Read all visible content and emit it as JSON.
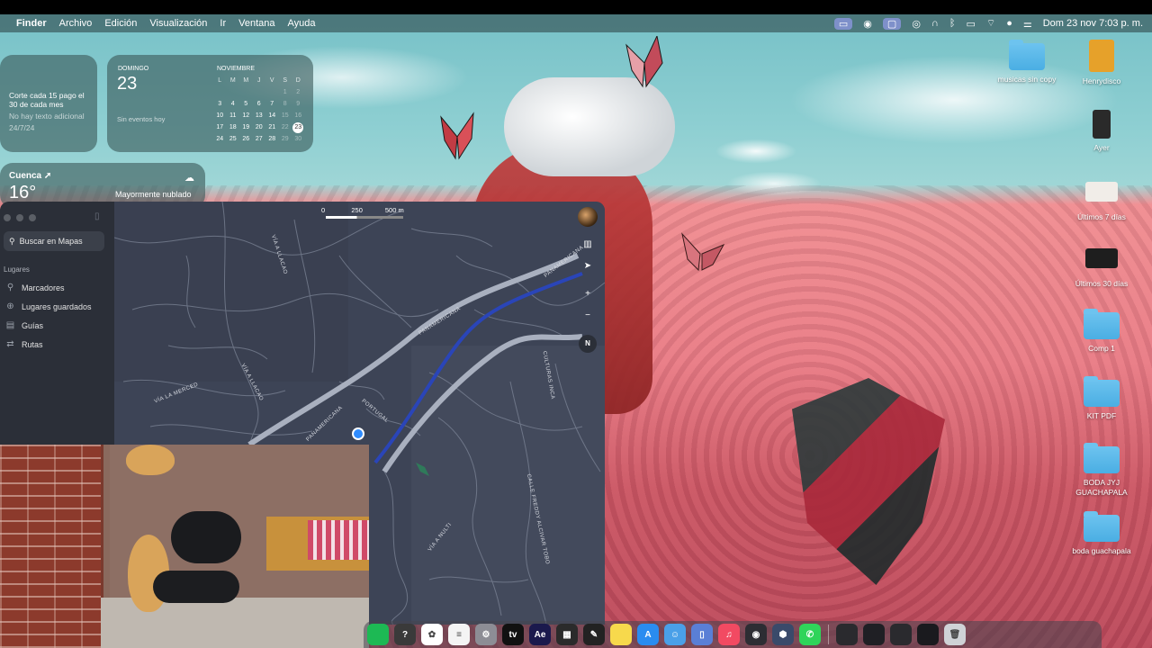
{
  "menubar": {
    "app": "Finder",
    "menus": [
      "Archivo",
      "Edición",
      "Visualización",
      "Ir",
      "Ventana",
      "Ayuda"
    ],
    "clock": "Dom 23 nov  7:03 p. m."
  },
  "widgets": {
    "reminder": {
      "text": "Corte cada 15 pago el 30 de cada mes",
      "note": "No hay texto adicional",
      "date": "24/7/24"
    },
    "calendar": {
      "day_name": "DOMINGO",
      "day_number": "23",
      "no_events": "Sin eventos hoy",
      "month": "NOVIEMBRE",
      "weekdays": [
        "L",
        "M",
        "M",
        "J",
        "V",
        "S",
        "D"
      ],
      "weeks": [
        [
          "",
          "",
          "",
          "",
          "",
          "1",
          "2"
        ],
        [
          "3",
          "4",
          "5",
          "6",
          "7",
          "8",
          "9"
        ],
        [
          "10",
          "11",
          "12",
          "13",
          "14",
          "15",
          "16"
        ],
        [
          "17",
          "18",
          "19",
          "20",
          "21",
          "22",
          "23"
        ],
        [
          "24",
          "25",
          "26",
          "27",
          "28",
          "29",
          "30"
        ]
      ]
    },
    "weather": {
      "city": "Cuenca",
      "temp": "16°",
      "condition": "Mayormente nublado"
    }
  },
  "maps": {
    "search_placeholder": "Buscar en Mapas",
    "places_heading": "Lugares",
    "sidebar_items": [
      {
        "label": "Marcadores",
        "icon": "pin-icon"
      },
      {
        "label": "Lugares guardados",
        "icon": "plus-circle-icon"
      },
      {
        "label": "Guías",
        "icon": "book-icon"
      },
      {
        "label": "Rutas",
        "icon": "route-icon"
      }
    ],
    "scale_labels": [
      "0",
      "250",
      "500 m"
    ],
    "compass": "N",
    "road_labels": [
      "PANAMERICANA",
      "PANAMERICANA",
      "PANAMERICANA",
      "VÍA A LLACAO",
      "VÍA A LLACAO",
      "VÍA LA MERCED",
      "PORTUGAL",
      "VÍA A NULTI",
      "CALLE FREDDY ALCIVAR TOBO",
      "CULTURAS INCA"
    ]
  },
  "desktop_icons": [
    {
      "label": "musicas sin copy",
      "kind": "folder"
    },
    {
      "label": "Henrydisco",
      "kind": "file"
    },
    {
      "label": "Ayer",
      "kind": "image"
    },
    {
      "label": "Últimos 7 días",
      "kind": "image"
    },
    {
      "label": "Últimos 30 días",
      "kind": "image"
    },
    {
      "label": "Comp 1",
      "kind": "folder"
    },
    {
      "label": "KIT PDF",
      "kind": "folder"
    },
    {
      "label": "BODA JYJ GUACHAPALA",
      "kind": "folder"
    },
    {
      "label": "boda guachapala",
      "kind": "folder"
    }
  ],
  "dock": [
    {
      "name": "spotify-icon",
      "glyph": "",
      "color": "#1db954"
    },
    {
      "name": "help-icon",
      "glyph": "?",
      "color": "#3a3a3a"
    },
    {
      "name": "photos-icon",
      "glyph": "✿",
      "color": "#ffffff"
    },
    {
      "name": "reminders-icon",
      "glyph": "≡",
      "color": "#f4f4f4"
    },
    {
      "name": "system-settings-icon",
      "glyph": "⚙",
      "color": "#8d8d95"
    },
    {
      "name": "apple-tv-icon",
      "glyph": "tv",
      "color": "#111111"
    },
    {
      "name": "after-effects-icon",
      "glyph": "Ae",
      "color": "#1b1a4d"
    },
    {
      "name": "final-cut-icon",
      "glyph": "▦",
      "color": "#2b2b2b"
    },
    {
      "name": "logic-icon",
      "glyph": "✎",
      "color": "#222222"
    },
    {
      "name": "notes-icon",
      "glyph": "",
      "color": "#f7d94c"
    },
    {
      "name": "app-store-icon",
      "glyph": "A",
      "color": "#2a8cf0"
    },
    {
      "name": "finder-icon",
      "glyph": "☺",
      "color": "#4aa0e8"
    },
    {
      "name": "preview-icon",
      "glyph": "▯",
      "color": "#5a7fd6"
    },
    {
      "name": "music-icon",
      "glyph": "♫",
      "color": "#f24a62"
    },
    {
      "name": "obs-icon",
      "glyph": "◉",
      "color": "#2d2d33"
    },
    {
      "name": "affinity-icon",
      "glyph": "⬢",
      "color": "#3a4a6a"
    },
    {
      "name": "whatsapp-icon",
      "glyph": "✆",
      "color": "#2fd45a"
    },
    {
      "name": "window-thumb-icon",
      "glyph": "",
      "color": "#2a2a2e"
    },
    {
      "name": "window-thumb-icon",
      "glyph": "",
      "color": "#1f1f24"
    },
    {
      "name": "window-thumb-icon",
      "glyph": "",
      "color": "#2a2a2e"
    },
    {
      "name": "window-thumb-icon",
      "glyph": "",
      "color": "#1a1a1e"
    },
    {
      "name": "trash-icon",
      "glyph": "🗑",
      "color": "#cfd2d6"
    }
  ]
}
